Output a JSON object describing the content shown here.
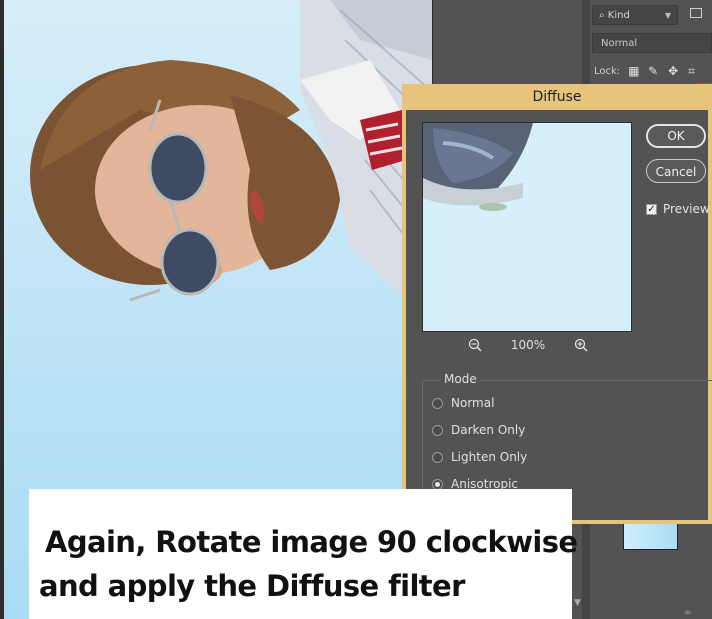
{
  "layers_panel": {
    "kind_filter": "Kind",
    "blend_mode": "Normal",
    "lock_label": "Lock:"
  },
  "dialog": {
    "title": "Diffuse",
    "ok_label": "OK",
    "cancel_label": "Cancel",
    "preview_label": "Preview",
    "preview_checked": true,
    "zoom_level": "100%",
    "mode_label": "Mode",
    "modes": [
      {
        "label": "Normal",
        "selected": false
      },
      {
        "label": "Darken Only",
        "selected": false
      },
      {
        "label": "Lighten Only",
        "selected": false
      },
      {
        "label": "Anisotropic",
        "selected": true
      }
    ]
  },
  "caption": {
    "line1": " Again, Rotate image 90 clockwise",
    "line2": "and apply the Diffuse filter"
  },
  "colors": {
    "dialog_border": "#e6c47c",
    "panel_bg": "#535353",
    "sky": "#c4e6f7"
  }
}
